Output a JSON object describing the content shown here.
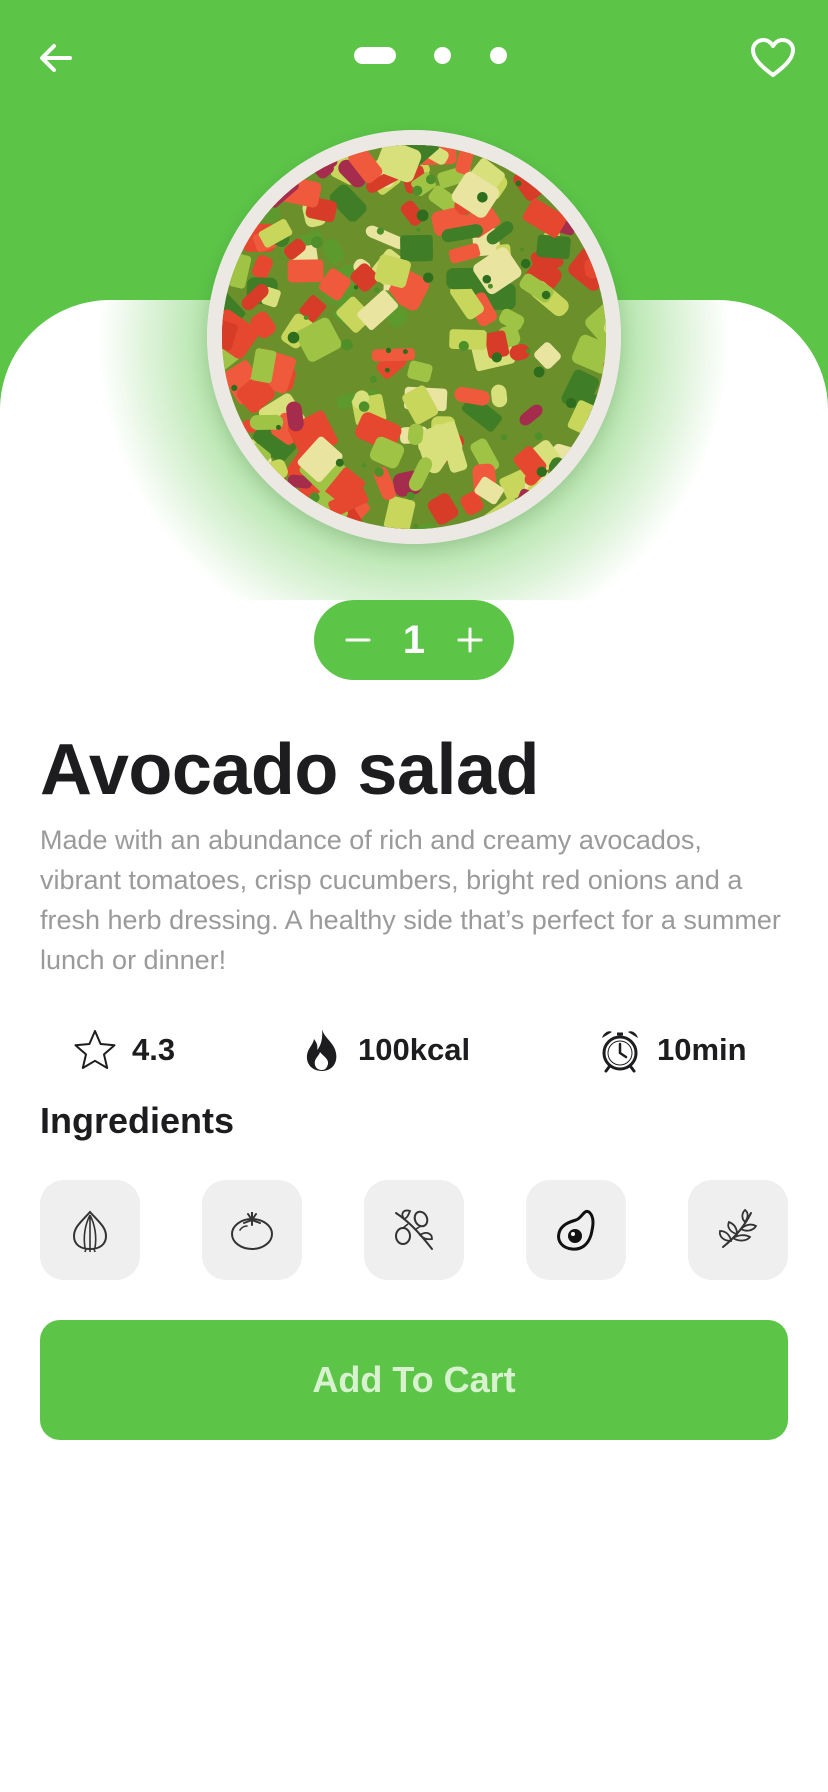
{
  "header": {
    "back_icon": "arrow-left-icon",
    "favorite_icon": "heart-outline-icon",
    "carousel_page_count": 3,
    "carousel_active_index": 0
  },
  "product": {
    "image_desc": "bowl-of-avocado-tomato-salad",
    "quantity": "1",
    "name": "Avocado salad",
    "description": "Made with an abundance of rich and creamy avocados, vibrant tomatoes, crisp cucumbers, bright red onions and a fresh herb dressing. A healthy side that’s perfect for a summer lunch or dinner!"
  },
  "stats": {
    "rating": "4.3",
    "calories": "100kcal",
    "time": "10min"
  },
  "ingredients": {
    "title": "Ingredients",
    "items": [
      "onion-icon",
      "tomato-icon",
      "olive-icon",
      "avocado-icon",
      "herb-leaf-icon"
    ]
  },
  "actions": {
    "add_to_cart_label": "Add To Cart"
  },
  "colors": {
    "accent": "#5cc548",
    "title_text": "#1d1d1f",
    "body_text": "#9a9a9a",
    "tile_bg": "#efefef",
    "button_text": "#d8f2cf"
  }
}
